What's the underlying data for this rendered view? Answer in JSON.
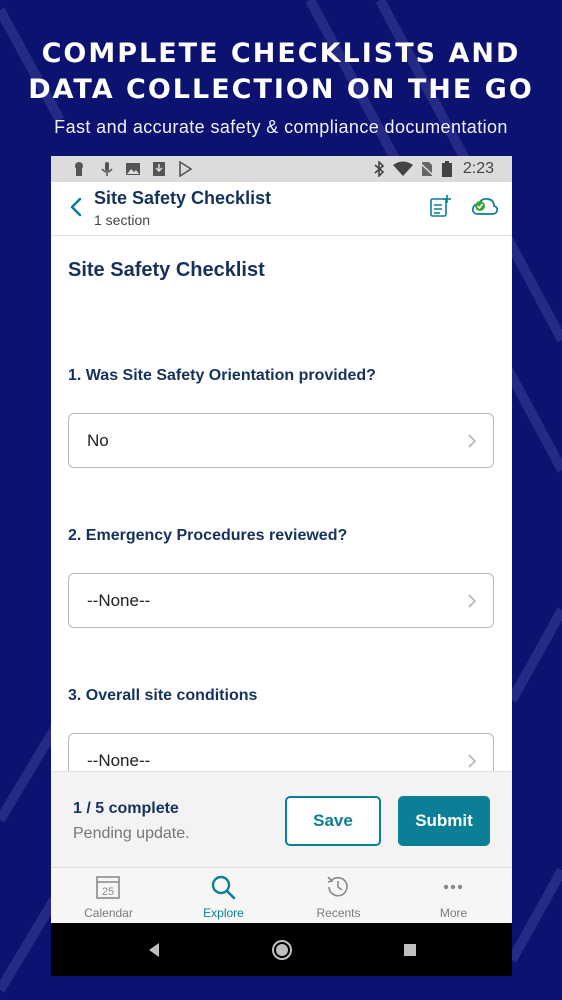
{
  "promo": {
    "title": "COMPLETE CHECKLISTS AND\nDATA COLLECTION ON THE GO",
    "subtitle": "Fast and accurate safety & compliance documentation"
  },
  "status_bar": {
    "time": "2:23",
    "left_icons": [
      "keyhole-icon",
      "mic-icon",
      "image-icon",
      "download-icon",
      "play-store-icon"
    ],
    "right_icons": [
      "bluetooth-icon",
      "wifi-icon",
      "no-sim-icon",
      "battery-icon"
    ]
  },
  "header": {
    "title": "Site Safety Checklist",
    "subtitle": "1 section"
  },
  "form": {
    "title": "Site Safety Checklist",
    "questions": [
      {
        "label": "1. Was Site Safety Orientation provided?",
        "value": "No"
      },
      {
        "label": "2. Emergency Procedures reviewed?",
        "value": "--None--"
      },
      {
        "label": "3. Overall site conditions",
        "value": "--None--"
      }
    ]
  },
  "footer": {
    "progress": "1 / 5 complete",
    "status": "Pending update.",
    "save_label": "Save",
    "submit_label": "Submit"
  },
  "tabs": [
    {
      "label": "Calendar",
      "icon": "calendar-icon",
      "calendar_day": "25",
      "active": false
    },
    {
      "label": "Explore",
      "icon": "search-icon",
      "active": true
    },
    {
      "label": "Recents",
      "icon": "history-icon",
      "active": false
    },
    {
      "label": "More",
      "icon": "more-dots-icon",
      "active": false
    }
  ],
  "colors": {
    "background": "#0c1270",
    "accent": "#0b7f95",
    "heading": "#16325c",
    "sync_ok": "#3aa53a"
  }
}
